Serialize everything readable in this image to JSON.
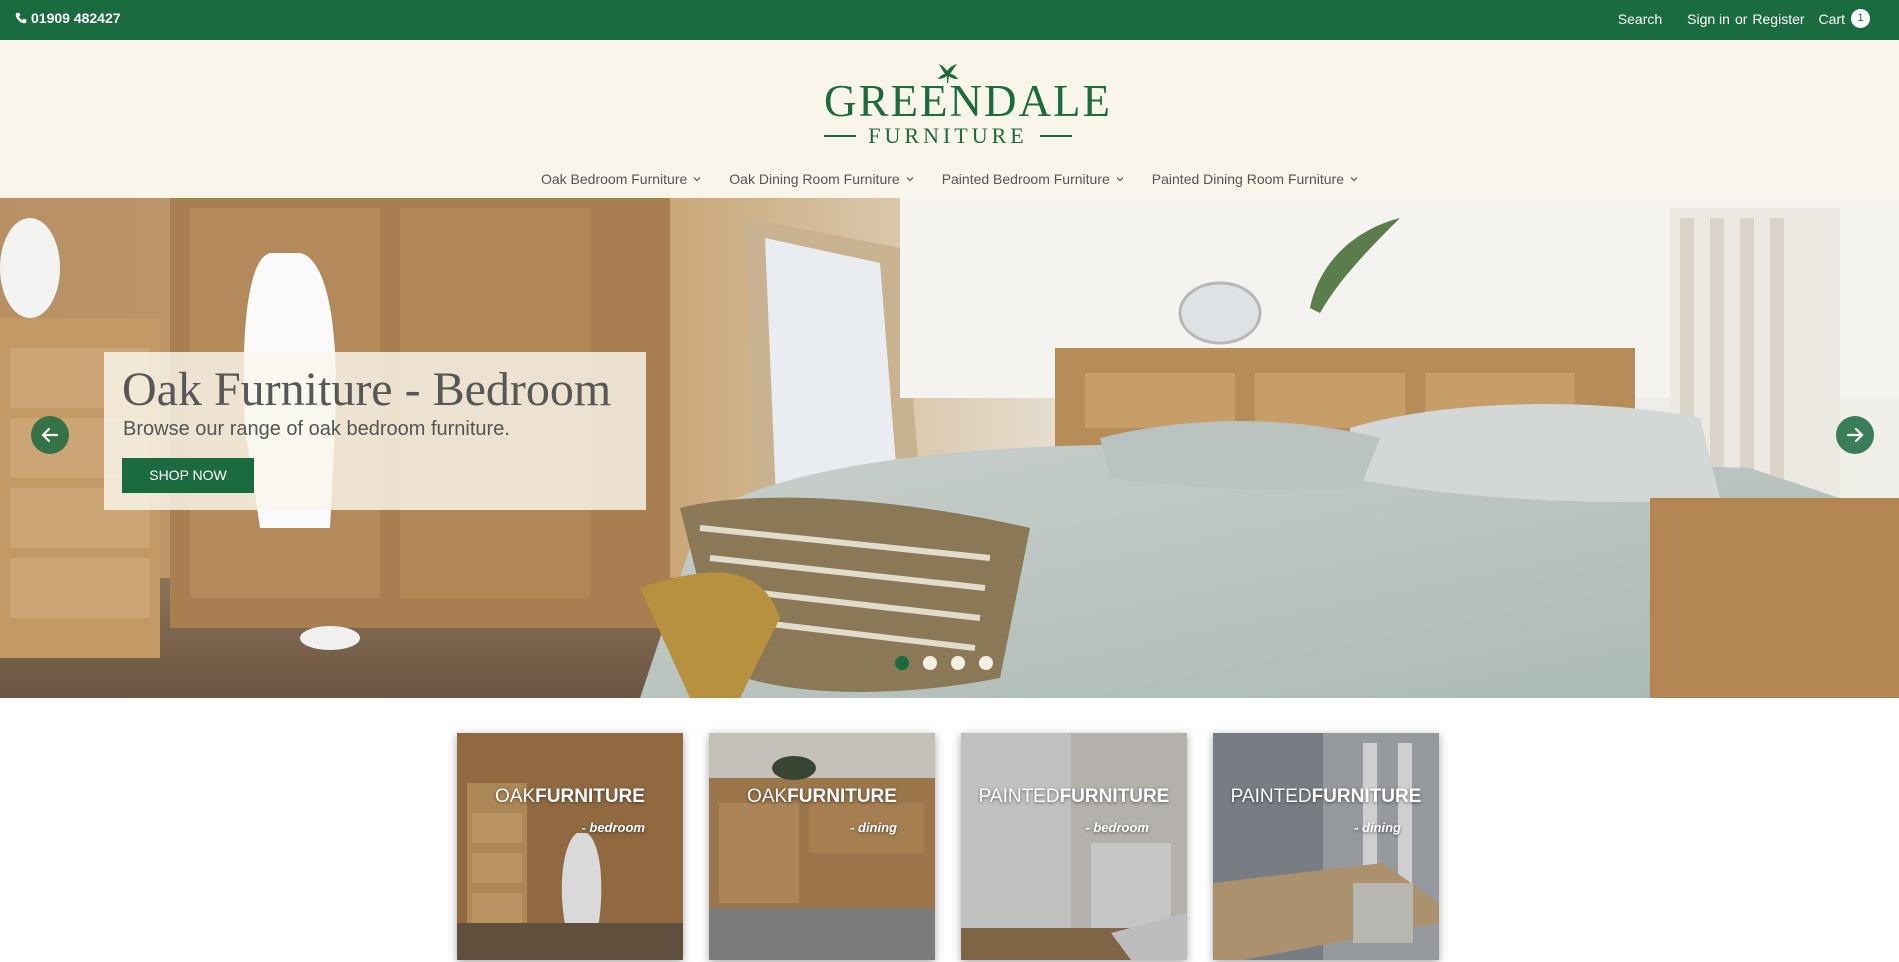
{
  "topbar": {
    "phone": "01909 482427",
    "search": "Search",
    "sign_in": "Sign in",
    "or": "or",
    "register": "Register",
    "cart": "Cart",
    "cart_count": "1"
  },
  "logo": {
    "name": "GREENDALE",
    "sub": "FURNITURE"
  },
  "nav": [
    {
      "label": "Oak Bedroom Furniture"
    },
    {
      "label": "Oak Dining Room Furniture"
    },
    {
      "label": "Painted Bedroom Furniture"
    },
    {
      "label": "Painted Dining Room Furniture"
    }
  ],
  "hero": {
    "title": "Oak Furniture - Bedroom",
    "description": "Browse our range of oak bedroom furniture.",
    "button": "SHOP NOW",
    "slide_count": 4,
    "active_slide": 1
  },
  "tiles": [
    {
      "light": "OAK",
      "bold": "FURNITURE",
      "sub": "- bedroom"
    },
    {
      "light": "OAK",
      "bold": "FURNITURE",
      "sub": "- dining"
    },
    {
      "light": "PAINTED",
      "bold": "FURNITURE",
      "sub": "- bedroom"
    },
    {
      "light": "PAINTED",
      "bold": "FURNITURE",
      "sub": "- dining"
    }
  ],
  "colors": {
    "brand_green": "#1a6b40",
    "header_bg": "#f9f5ea"
  }
}
